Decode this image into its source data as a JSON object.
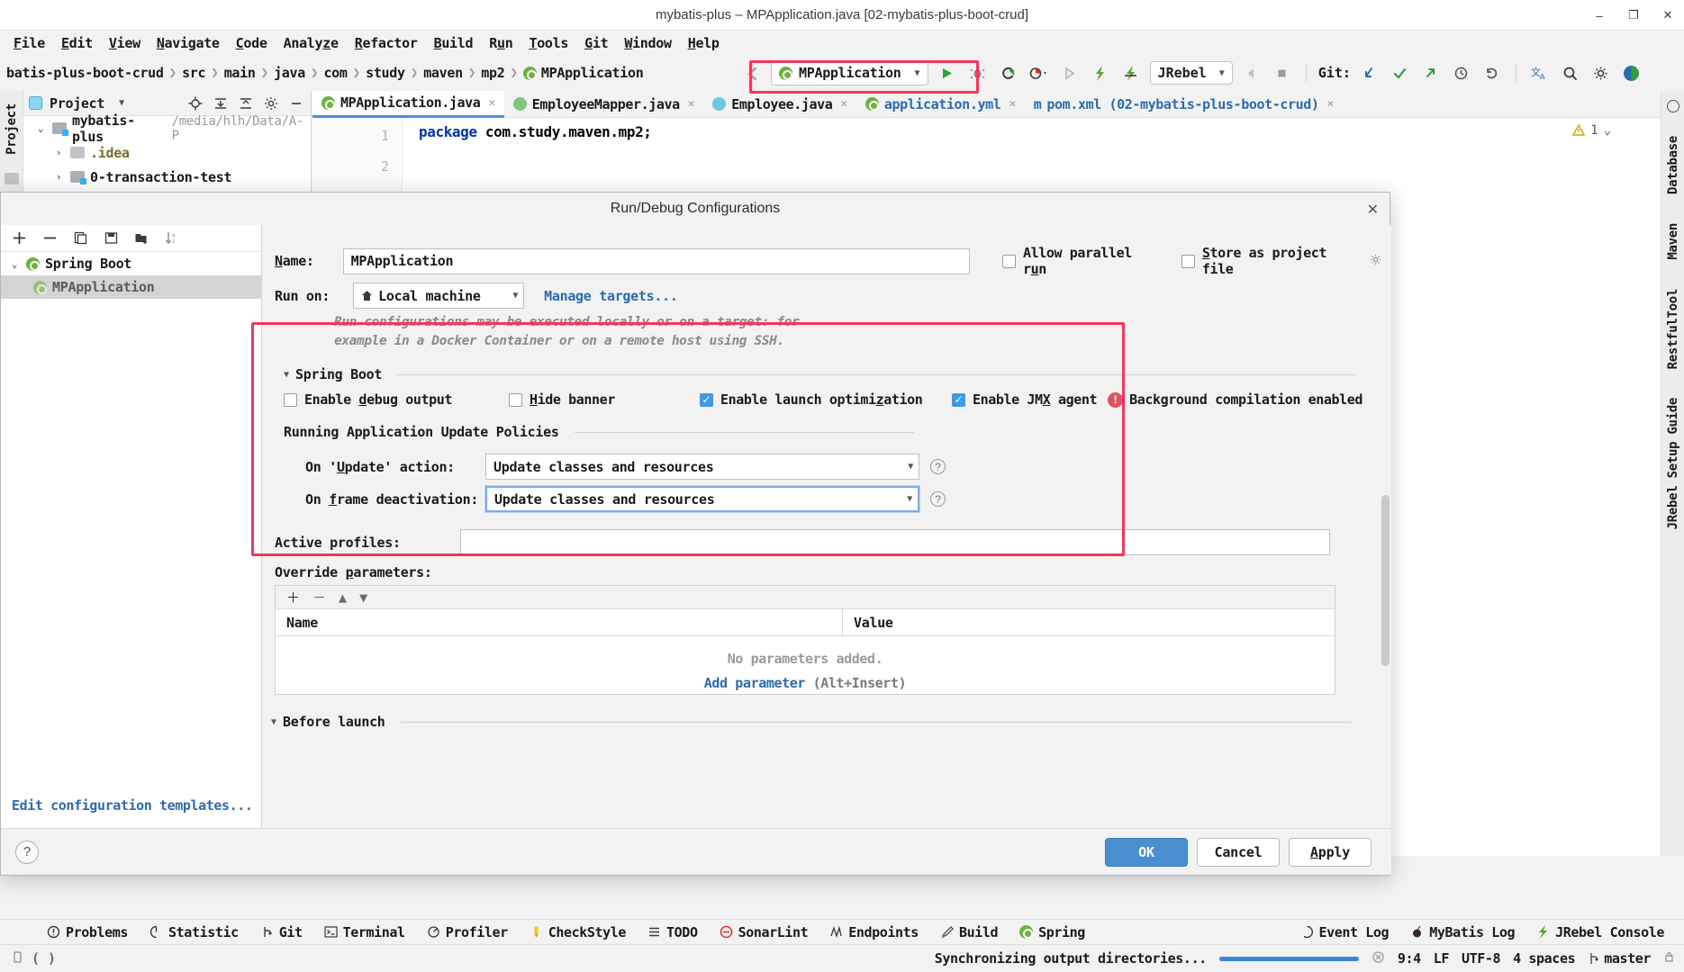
{
  "window": {
    "title": "mybatis-plus – MPApplication.java [02-mybatis-plus-boot-crud]",
    "minimize": "–",
    "restore": "❐",
    "close": "✕"
  },
  "menubar": [
    {
      "label": "File",
      "mnemonic": "F"
    },
    {
      "label": "Edit",
      "mnemonic": "E"
    },
    {
      "label": "View",
      "mnemonic": "V"
    },
    {
      "label": "Navigate",
      "mnemonic": "N"
    },
    {
      "label": "Code",
      "mnemonic": "C"
    },
    {
      "label": "Analyze",
      "mnemonic": "z"
    },
    {
      "label": "Refactor",
      "mnemonic": "R"
    },
    {
      "label": "Build",
      "mnemonic": "B"
    },
    {
      "label": "Run",
      "mnemonic": "u"
    },
    {
      "label": "Tools",
      "mnemonic": "T"
    },
    {
      "label": "Git",
      "mnemonic": "G"
    },
    {
      "label": "Window",
      "mnemonic": "W"
    },
    {
      "label": "Help",
      "mnemonic": "H"
    }
  ],
  "breadcrumbs": [
    "batis-plus-boot-crud",
    "src",
    "main",
    "java",
    "com",
    "study",
    "maven",
    "mp2",
    "MPApplication"
  ],
  "toolbar": {
    "back_icon": "back-arrow-icon",
    "run_config_name": "MPApplication",
    "run_config_caret": "▼",
    "run_icon": "run-icon",
    "debug_icon": "debug-icon",
    "run_coverage_icon": "run-with-coverage-icon",
    "profile_icon": "profile-icon",
    "jrebel_label": "JRebel",
    "jrebel_caret": "▼",
    "git_label": "Git:",
    "git_update_icon": "git-update-icon",
    "git_commit_icon": "git-commit-icon",
    "git_push_icon": "git-push-icon",
    "git_history_icon": "git-history-icon",
    "git_revert_icon": "git-revert-icon",
    "translate_icon": "translate-icon",
    "search_icon": "search-icon",
    "settings_icon": "gear-icon"
  },
  "stripes": {
    "left": [
      "Project"
    ],
    "right": [
      "Database",
      "Maven",
      "RestfulTool",
      "JRebel Setup Guide"
    ]
  },
  "project_panel": {
    "title": "Project",
    "title_caret": "▼",
    "tools": [
      "locate-icon",
      "expand-all-icon",
      "collapse-all-icon",
      "gear-icon",
      "hide-icon"
    ],
    "tree": [
      {
        "arrow": "⌄",
        "label": "mybatis-plus",
        "path": "/media/hlh/Data/A-P",
        "indent": 0,
        "icon": "module-folder-icon"
      },
      {
        "arrow": "›",
        "label": ".idea",
        "path": "",
        "indent": 1,
        "icon": "folder-icon"
      },
      {
        "arrow": "›",
        "label": "0-transaction-test",
        "path": "",
        "indent": 1,
        "icon": "module-folder-icon"
      }
    ]
  },
  "editor": {
    "tabs": [
      {
        "label": "MPApplication.java",
        "icon": "spring-class-icon",
        "active": true,
        "blue": false
      },
      {
        "label": "EmployeeMapper.java",
        "icon": "interface-icon",
        "active": false,
        "blue": false
      },
      {
        "label": "Employee.java",
        "icon": "class-icon",
        "active": false,
        "blue": false
      },
      {
        "label": "application.yml",
        "icon": "spring-yaml-icon",
        "active": false,
        "blue": true
      },
      {
        "label": "pom.xml (02-mybatis-plus-boot-crud)",
        "icon": "maven-icon",
        "active": false,
        "blue": true
      }
    ],
    "lines": [
      {
        "no": "1",
        "kw": "package",
        "rest": " com.study.maven.mp2;"
      },
      {
        "no": "2",
        "kw": "",
        "rest": ""
      }
    ],
    "warning_count": "1",
    "warning_caret": "⌄"
  },
  "dialog": {
    "title": "Run/Debug Configurations",
    "close": "✕",
    "left_toolbar": [
      "add-icon",
      "remove-icon",
      "copy-icon",
      "save-icon",
      "new-folder-icon",
      "sort-icon"
    ],
    "config_tree": [
      {
        "label": "Spring Boot",
        "arrow": "⌄",
        "selected": false,
        "indent": 0
      },
      {
        "label": "MPApplication",
        "arrow": "",
        "selected": true,
        "indent": 1
      }
    ],
    "edit_templates_link": "Edit configuration templates...",
    "name_label": "Name:",
    "name_mnemonic": "N",
    "name_value": "MPApplication",
    "allow_parallel_run": {
      "label": "Allow parallel run",
      "mnemonic": "u",
      "checked": false
    },
    "store_as_project_file": {
      "label": "Store as project file",
      "mnemonic": "S",
      "checked": false,
      "gear": "gear-icon"
    },
    "run_on_label": "Run on:",
    "run_on_value": "Local machine",
    "run_on_icon": "local-machine-icon",
    "manage_targets_link": "Manage targets...",
    "hint_line1": "Run configurations may be executed locally or on a target: for",
    "hint_line2": "example in a Docker Container or on a remote host using SSH.",
    "spring_boot_section": "Spring Boot",
    "checkboxes": [
      {
        "label": "Enable debug output",
        "mnemonic": "d",
        "checked": false,
        "name": "enable-debug-output"
      },
      {
        "label": "Hide banner",
        "mnemonic": "H",
        "checked": false,
        "name": "hide-banner"
      },
      {
        "label": "Enable launch optimization",
        "mnemonic": "z",
        "checked": true,
        "name": "enable-launch-optimization"
      },
      {
        "label": "Enable JMX agent",
        "mnemonic": "X",
        "checked": true,
        "name": "enable-jmx-agent"
      }
    ],
    "background_compilation": {
      "label": "Background compilation enabled",
      "icon": "error-icon"
    },
    "update_policies_section": "Running Application Update Policies",
    "on_update_label": "On 'Update' action:",
    "on_update_mnemonic": "U",
    "on_update_value": "Update classes and resources",
    "on_frame_label": "On frame deactivation:",
    "on_frame_mnemonic": "f",
    "on_frame_value": "Update classes and resources",
    "help_icon": "help-icon",
    "active_profiles_label": "Active profiles:",
    "active_profiles_value": "",
    "override_params_label": "Override parameters:",
    "override_params_mnemonic": "p",
    "param_toolbar": [
      "add-icon",
      "remove-icon",
      "move-up-icon",
      "move-down-icon"
    ],
    "param_columns": [
      "Name",
      "Value"
    ],
    "param_empty_text": "No parameters added.",
    "param_add_link": "Add parameter",
    "param_add_shortcut": "(Alt+Insert)",
    "before_launch_section": "Before launch",
    "before_launch_mnemonic": "B",
    "footer": {
      "help": "?",
      "ok": "OK",
      "cancel": "Cancel",
      "apply": "Apply",
      "apply_mnemonic": "A"
    }
  },
  "toolwindow_bar": [
    {
      "label": "Problems",
      "icon": "problems-icon"
    },
    {
      "label": "Statistic",
      "icon": "statistic-icon"
    },
    {
      "label": "Git",
      "icon": "git-icon"
    },
    {
      "label": "Terminal",
      "icon": "terminal-icon"
    },
    {
      "label": "Profiler",
      "icon": "profiler-icon"
    },
    {
      "label": "CheckStyle",
      "icon": "checkstyle-icon"
    },
    {
      "label": "TODO",
      "icon": "todo-icon"
    },
    {
      "label": "SonarLint",
      "icon": "sonarlint-icon"
    },
    {
      "label": "Endpoints",
      "icon": "endpoints-icon"
    },
    {
      "label": "Build",
      "icon": "build-icon"
    },
    {
      "label": "Spring",
      "icon": "spring-icon"
    }
  ],
  "toolwindow_bar_right": [
    {
      "label": "Event Log",
      "icon": "event-log-icon"
    },
    {
      "label": "MyBatis Log",
      "icon": "mybatis-log-icon"
    },
    {
      "label": "JRebel Console",
      "icon": "jrebel-icon"
    }
  ],
  "statusbar": {
    "left_icons": [
      "mobile-icon",
      "brackets-icon"
    ],
    "message": "Synchronizing output directories...",
    "progress_percent": 100,
    "cancel_icon": "cancel-icon",
    "caret_position": "9:4",
    "line_separator": "LF",
    "encoding": "UTF-8",
    "indent": "4 spaces",
    "branch": "master",
    "branch_icon": "branch-icon",
    "lock_icon": "lock-icon"
  },
  "colors": {
    "accent_blue": "#4a8fd0",
    "link_blue": "#2b6cb0",
    "highlight_red": "#f5365c",
    "checkbox_checked": "#3d9ae8",
    "error_red": "#e05260",
    "spring_green": "#6db33f"
  }
}
